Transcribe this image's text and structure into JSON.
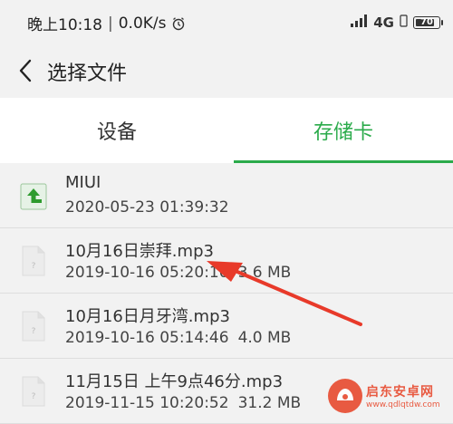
{
  "status_bar": {
    "time": "晚上10:18",
    "separator": "|",
    "speed": "0.0K/s",
    "network": "4G",
    "battery": "70"
  },
  "header": {
    "title": "选择文件"
  },
  "tabs": [
    {
      "label": "设备",
      "active": false
    },
    {
      "label": "存储卡",
      "active": true
    }
  ],
  "files": [
    {
      "name": "MIUI",
      "date": "2020-05-23 01:39:32",
      "size": "",
      "type": "folder-up"
    },
    {
      "name": "10月16日崇拜.mp3",
      "date": "2019-10-16 05:20:10",
      "size": "3.6 MB",
      "type": "unknown"
    },
    {
      "name": "10月16日月牙湾.mp3",
      "date": "2019-10-16 05:14:46",
      "size": "4.0 MB",
      "type": "unknown"
    },
    {
      "name": "11月15日 上午9点46分.mp3",
      "date": "2019-11-15 10:20:52",
      "size": "31.2 MB",
      "type": "unknown"
    }
  ],
  "watermark": {
    "name": "启东安卓网",
    "url": "www.qdlqtdw.com"
  },
  "colors": {
    "accent": "#2bab4b",
    "annotation_arrow": "#e83a2a"
  }
}
